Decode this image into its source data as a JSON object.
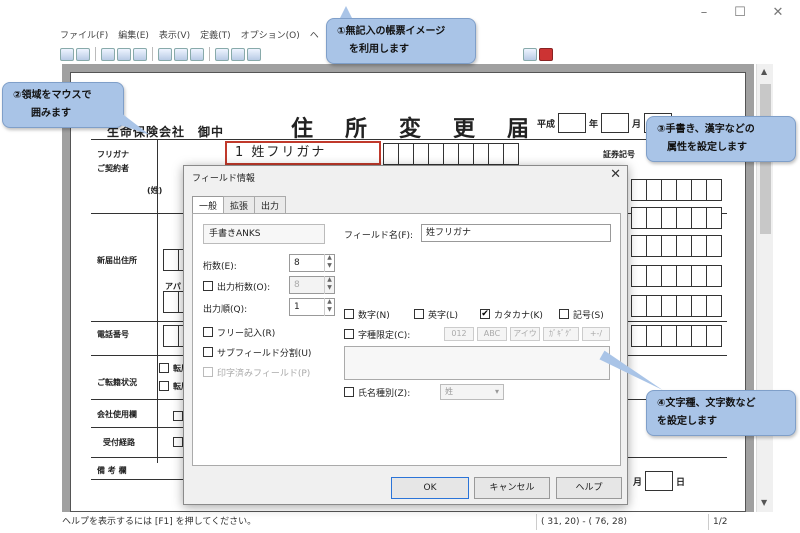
{
  "window": {
    "minimize": "–",
    "maximize": "☐",
    "close": "✕"
  },
  "menu": [
    "ファイル(F)",
    "編集(E)",
    "表示(V)",
    "定義(T)",
    "オプション(O)",
    "ヘ"
  ],
  "form": {
    "company": "生命保険会社　御中",
    "title": "住所変更届",
    "era": "平成",
    "year": "年",
    "month": "月",
    "day": "日",
    "label_furigana": "フリガナ",
    "label_contractor": "ご契約者",
    "label_sei": "(姓)",
    "label_new_address": "新届出住所",
    "label_apart": "アパ",
    "label_phone": "電話番号",
    "label_transfer": "ご転籍状況",
    "transfer_1": "転居",
    "transfer_2": "転居",
    "label_company_use": "会社使用欄",
    "label_route": "受付経路",
    "label_notes": "備 考 欄",
    "label_cert_no": "証券記号",
    "cert_dash": "－",
    "red_field_text": "1 姓フリガナ",
    "bottom_month": "月",
    "bottom_day": "日"
  },
  "dialog": {
    "title": "フィールド情報",
    "close": "✕",
    "tabs": [
      "一般",
      "拡張",
      "出力"
    ],
    "field_type": "手書きANKS",
    "field_name_label": "フィールド名(F):",
    "field_name_value": "姓フリガナ",
    "digits_label": "桁数(E):",
    "digits_value": "8",
    "output_digits_label": "出力桁数(O):",
    "output_digits_value": "8",
    "output_order_label": "出力順(Q):",
    "output_order_value": "1",
    "free_entry_label": "フリー記入(R)",
    "subfield_label": "サブフィールド分割(U)",
    "printed_field_label": "印字済みフィールド(P)",
    "numeric_label": "数字(N)",
    "alpha_label": "英字(L)",
    "katakana_label": "カタカナ(K)",
    "katakana_checked": true,
    "symbol_label": "記号(S)",
    "char_limit_label": "字種限定(C):",
    "char_buttons": [
      "012",
      "ABC",
      "アイウ",
      "ｶﾞｷﾞｸﾞ",
      "+-/"
    ],
    "name_type_label": "氏名種別(Z):",
    "name_type_value": "姓",
    "ok": "OK",
    "cancel": "キャンセル",
    "help": "ヘルプ"
  },
  "status": {
    "help_text": "ヘルプを表示するには [F1] を押してください。",
    "coords": "( 31, 20) - ( 76, 28)",
    "page": "1/2"
  },
  "callouts": {
    "c1_line1": "①無記入の帳票イメージ",
    "c1_line2": "を利用します",
    "c2_line1": "②領域をマウスで",
    "c2_line2": "囲みます",
    "c3_line1": "③手書き、漢字などの",
    "c3_line2": "属性を設定します",
    "c4_line1": "④文字種、文字数など",
    "c4_line2": "を設定します"
  },
  "colors": {
    "callout_bg": "#a9c4e7",
    "selection_red": "#c0392b",
    "canvas_gray": "#a0a0a0"
  }
}
